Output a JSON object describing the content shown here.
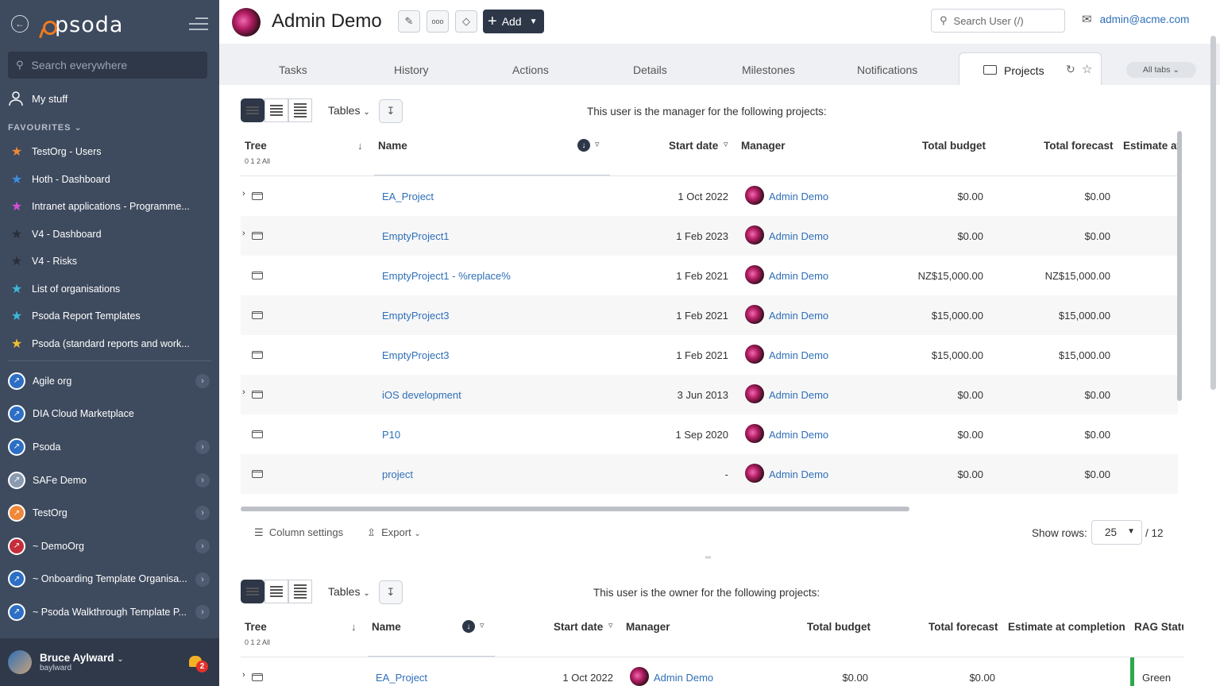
{
  "sidebar": {
    "search_placeholder": "Search everywhere",
    "my_stuff": "My stuff",
    "favourites_label": "FAVOURITES",
    "favourites": [
      {
        "label": "TestOrg - Users",
        "color": "#f0883a"
      },
      {
        "label": "Hoth - Dashboard",
        "color": "#3b8ee0"
      },
      {
        "label": "Intranet applications - Programme...",
        "color": "#d64fd8"
      },
      {
        "label": "V4 - Dashboard",
        "color": "#2a2f3a"
      },
      {
        "label": "V4 - Risks",
        "color": "#2a2f3a"
      },
      {
        "label": "List of organisations",
        "color": "#3bb8d8"
      },
      {
        "label": "Psoda Report Templates",
        "color": "#3bb8d8"
      },
      {
        "label": "Psoda (standard reports and work...",
        "color": "#f0c030"
      }
    ],
    "orgs": [
      {
        "label": "Agile org",
        "chevron": true
      },
      {
        "label": "DIA Cloud Marketplace",
        "chevron": false
      },
      {
        "label": "Psoda",
        "chevron": true
      },
      {
        "label": "SAFe Demo",
        "chevron": true
      },
      {
        "label": "TestOrg",
        "chevron": true
      },
      {
        "label": "~ DemoOrg",
        "chevron": true
      },
      {
        "label": "~ Onboarding Template Organisa...",
        "chevron": true
      },
      {
        "label": "~ Psoda Walkthrough Template P...",
        "chevron": true
      }
    ],
    "user": {
      "name": "Bruce Aylward",
      "login": "baylward",
      "notifications": "2"
    }
  },
  "header": {
    "title": "Admin Demo",
    "add_label": "Add",
    "search_placeholder": "Search User (/)",
    "email": "admin@acme.com"
  },
  "tabs": [
    "Tasks",
    "History",
    "Actions",
    "Details",
    "Milestones",
    "Notifications"
  ],
  "active_tab": "Projects",
  "all_tabs": "All tabs",
  "section1": {
    "tables_label": "Tables",
    "intro": "This user is the manager for the following projects:",
    "tree_label": "Tree",
    "tree_levels": "0 1 2 All",
    "columns": {
      "name": "Name",
      "start": "Start date",
      "manager": "Manager",
      "budget": "Total budget",
      "forecast": "Total forecast",
      "estimate": "Estimate at"
    },
    "rows": [
      {
        "name": "EA_Project",
        "start": "1 Oct 2022",
        "manager": "Admin Demo",
        "budget": "$0.00",
        "forecast": "$0.00",
        "expand": true
      },
      {
        "name": "EmptyProject1",
        "start": "1 Feb 2023",
        "manager": "Admin Demo",
        "budget": "$0.00",
        "forecast": "$0.00",
        "expand": true
      },
      {
        "name": "EmptyProject1 - %replace%",
        "start": "1 Feb 2021",
        "manager": "Admin Demo",
        "budget": "NZ$15,000.00",
        "forecast": "NZ$15,000.00",
        "expand": false
      },
      {
        "name": "EmptyProject3",
        "start": "1 Feb 2021",
        "manager": "Admin Demo",
        "budget": "$15,000.00",
        "forecast": "$15,000.00",
        "expand": false
      },
      {
        "name": "EmptyProject3",
        "start": "1 Feb 2021",
        "manager": "Admin Demo",
        "budget": "$15,000.00",
        "forecast": "$15,000.00",
        "expand": false
      },
      {
        "name": "iOS development",
        "start": "3 Jun 2013",
        "manager": "Admin Demo",
        "budget": "$0.00",
        "forecast": "$0.00",
        "expand": true
      },
      {
        "name": "P10",
        "start": "1 Sep 2020",
        "manager": "Admin Demo",
        "budget": "$0.00",
        "forecast": "$0.00",
        "expand": false
      },
      {
        "name": "project",
        "start": "-",
        "manager": "Admin Demo",
        "budget": "$0.00",
        "forecast": "$0.00",
        "expand": false
      }
    ],
    "column_settings": "Column settings",
    "export": "Export",
    "show_rows_label": "Show rows:",
    "show_rows_value": "25",
    "total": "/ 12"
  },
  "section2": {
    "tables_label": "Tables",
    "intro": "This user is the owner for the following projects:",
    "tree_label": "Tree",
    "tree_levels": "0 1 2 All",
    "columns": {
      "name": "Name",
      "start": "Start date",
      "manager": "Manager",
      "budget": "Total budget",
      "forecast": "Total forecast",
      "estimate": "Estimate at completion",
      "rag": "RAG Statu"
    },
    "rows": [
      {
        "name": "EA_Project",
        "start": "1 Oct 2022",
        "manager": "Admin Demo",
        "budget": "$0.00",
        "forecast": "$0.00",
        "rag": "Green",
        "rag_color": "#2da84b"
      }
    ]
  }
}
